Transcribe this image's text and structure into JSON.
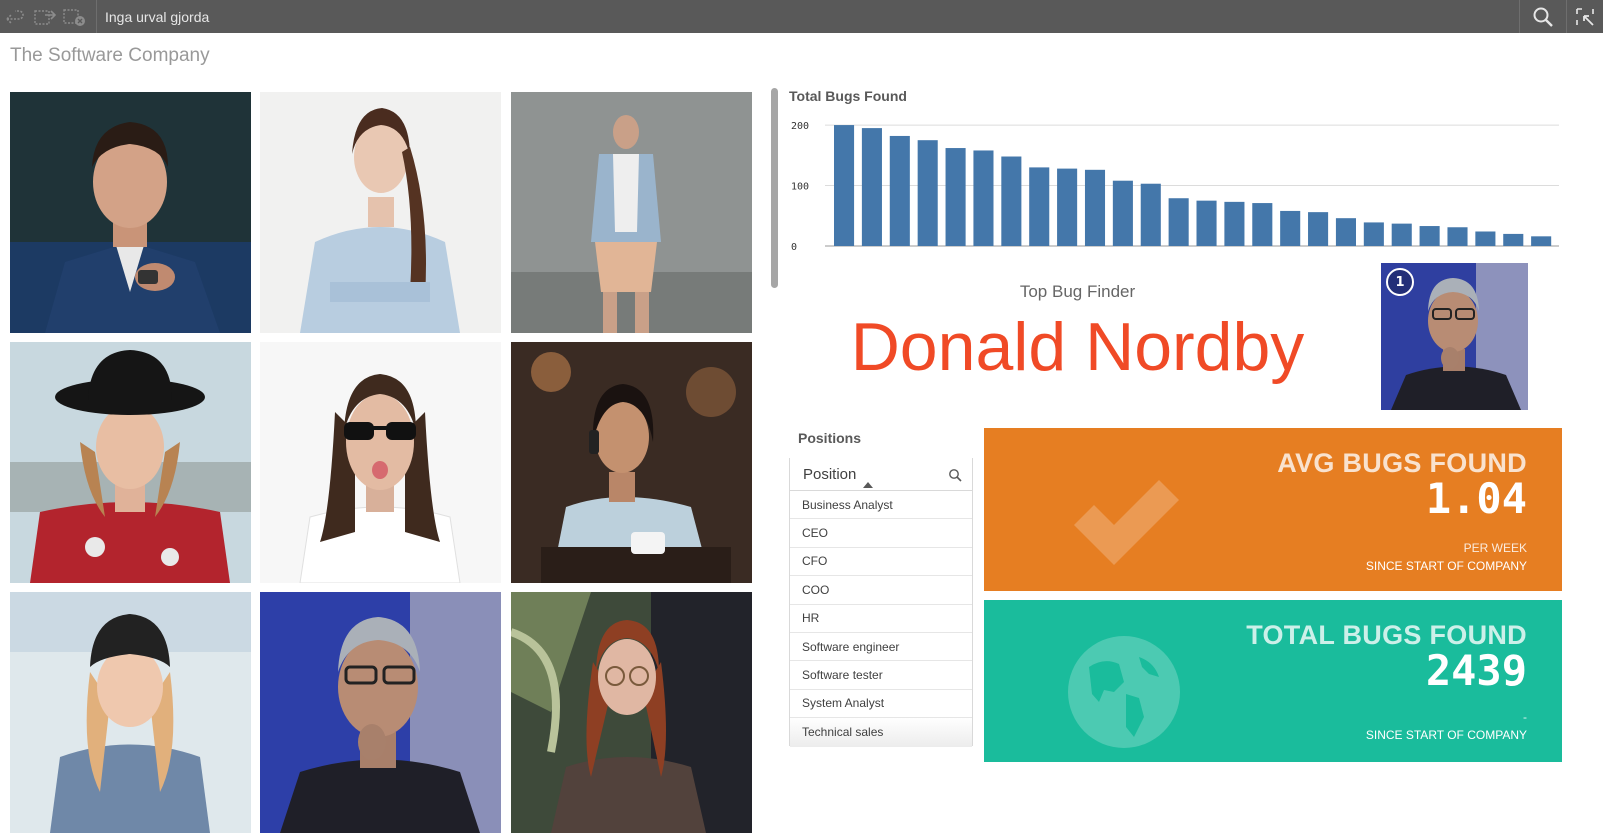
{
  "toolbar": {
    "selections_text": "Inga urval gjorda",
    "icons": [
      "step-back-icon",
      "step-forward-icon",
      "clear-selections-icon",
      "search-icon",
      "selections-tool-icon"
    ]
  },
  "sheet": {
    "title": "The Software Company"
  },
  "photos": [
    "man-in-blue-suit",
    "woman-with-braid",
    "man-in-shorts",
    "woman-in-black-hat",
    "man-with-sunglasses",
    "woman-on-phone",
    "woman-in-beanie",
    "man-with-glasses",
    "woman-with-glasses"
  ],
  "bugs_chart": {
    "title": "Total Bugs Found",
    "chart_data": {
      "type": "bar",
      "title": "Total Bugs Found",
      "xlabel": "",
      "ylabel": "",
      "ylim": [
        0,
        215
      ],
      "yticks": [
        "200",
        "100",
        "0"
      ],
      "grid": true,
      "values": [
        200,
        195,
        182,
        175,
        162,
        158,
        148,
        130,
        128,
        126,
        108,
        103,
        79,
        75,
        73,
        71,
        58,
        56,
        46,
        39,
        37,
        33,
        31,
        24,
        20,
        16
      ]
    }
  },
  "top_bug_finder": {
    "label": "Top Bug Finder",
    "name": "Donald Nordby",
    "rank": "1"
  },
  "positions": {
    "title": "Positions",
    "column_label": "Position",
    "items": [
      "Business Analyst",
      "CEO",
      "CFO",
      "COO",
      "HR",
      "Software engineer",
      "Software tester",
      "System Analyst",
      "Technical sales"
    ]
  },
  "kpi_avg": {
    "title": "AVG BUGS FOUND",
    "value": "1.04",
    "sub1": "PER WEEK",
    "sub2": "SINCE START OF COMPANY",
    "color": "#e67e22",
    "icon": "checkmark-icon"
  },
  "kpi_total": {
    "title": "TOTAL BUGS FOUND",
    "value": "2439",
    "sub1": "-",
    "sub2": "SINCE START OF COMPANY",
    "color": "#1abc9c",
    "icon": "globe-icon"
  },
  "colors": {
    "bar": "#4477aa",
    "accent_name": "#f04a26",
    "toolbar": "#595959"
  }
}
